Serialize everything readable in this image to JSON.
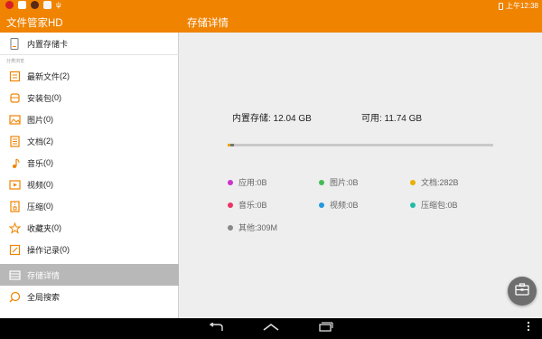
{
  "status_bar": {
    "time": "上午12:38"
  },
  "action_bar": {
    "app_title": "文件管家HD",
    "detail_title": "存储详情"
  },
  "sidebar": {
    "storage_item": {
      "label": "内置存储卡",
      "icon": "sdcard-icon"
    },
    "section_label": "分类浏览",
    "categories": [
      {
        "label": "最新文件",
        "count": "(2)",
        "icon": "recent-files-icon"
      },
      {
        "label": "安装包",
        "count": "(0)",
        "icon": "package-icon"
      },
      {
        "label": "图片",
        "count": "(0)",
        "icon": "image-icon"
      },
      {
        "label": "文档",
        "count": "(2)",
        "icon": "document-icon"
      },
      {
        "label": "音乐",
        "count": "(0)",
        "icon": "music-icon"
      },
      {
        "label": "视频",
        "count": "(0)",
        "icon": "video-icon"
      },
      {
        "label": "压缩",
        "count": "(0)",
        "icon": "archive-icon"
      },
      {
        "label": "收藏夹",
        "count": "(0)",
        "icon": "star-icon"
      },
      {
        "label": "操作记录",
        "count": "(0)",
        "icon": "history-icon"
      }
    ],
    "storage_detail": {
      "label": "存储详情",
      "icon": "storage-detail-icon"
    },
    "global_search": {
      "label": "全局搜索",
      "icon": "search-icon"
    }
  },
  "main": {
    "total_storage": "内置存储: 12.04 GB",
    "available_storage": "可用: 11.74 GB",
    "usage_fraction": 0.025,
    "legend": [
      {
        "label": "应用:0B",
        "color": "#cc33cc"
      },
      {
        "label": "图片:0B",
        "color": "#44bb55"
      },
      {
        "label": "文档:282B",
        "color": "#e8b000"
      },
      {
        "label": "音乐:0B",
        "color": "#ee3366"
      },
      {
        "label": "视频:0B",
        "color": "#2299dd"
      },
      {
        "label": "压缩包:0B",
        "color": "#22bbaa"
      },
      {
        "label": "其他:309M",
        "color": "#888888"
      }
    ]
  },
  "colors": {
    "accent": "#f08300",
    "active_item": "#b8b8b8"
  }
}
